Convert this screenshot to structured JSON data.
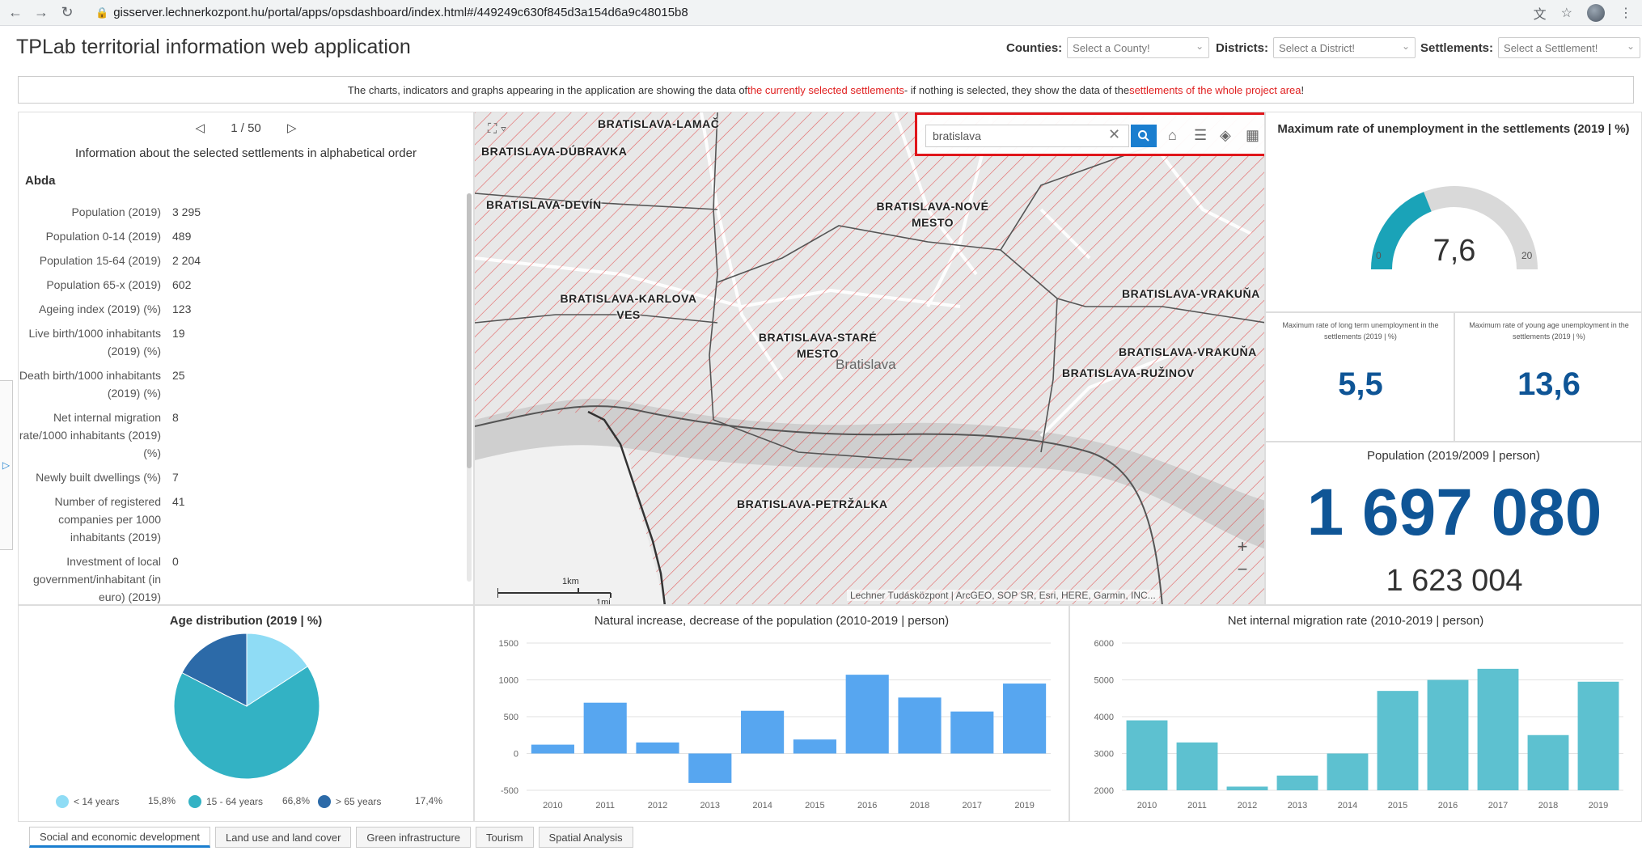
{
  "browser": {
    "url": "gisserver.lechnerkozpont.hu/portal/apps/opsdashboard/index.html#/449249c630f845d3a154d6a9c48015b8"
  },
  "app": {
    "title": "TPLab territorial information web application",
    "filters": [
      {
        "label": "Counties:",
        "placeholder": "Select a County!"
      },
      {
        "label": "Districts:",
        "placeholder": "Select a District!"
      },
      {
        "label": "Settlements:",
        "placeholder": "Select a Settlement!"
      }
    ]
  },
  "notice": {
    "part1": "The charts, indicators and graphs appearing in the application are showing the data of ",
    "part2": "the currently selected settlements",
    "part3": " - if nothing is selected, they show the data of the ",
    "part4": "settlements of the whole project area",
    "part5": "!"
  },
  "list": {
    "pager": "1 / 50",
    "title": "Information about the selected settlements in alphabetical order",
    "name": "Abda",
    "rows": [
      {
        "k": "Population (2019)",
        "v": "3 295"
      },
      {
        "k": "Population 0-14 (2019)",
        "v": "489"
      },
      {
        "k": "Population 15-64 (2019)",
        "v": "2 204"
      },
      {
        "k": "Population 65-x (2019)",
        "v": "602"
      },
      {
        "k": "Ageing index (2019) (%)",
        "v": "123"
      },
      {
        "k": "Live birth/1000 inhabitants (2019) (%)",
        "v": "19"
      },
      {
        "k": "Death birth/1000 inhabitants (2019) (%)",
        "v": "25"
      },
      {
        "k": "Net internal migration rate/1000 inhabitants (2019) (%)",
        "v": "8"
      },
      {
        "k": "Newly built dwellings (%)",
        "v": "7"
      },
      {
        "k": "Number of registered companies per 1000 inhabitants (2019)",
        "v": "41"
      },
      {
        "k": "Investment of local government/inhabitant (in euro) (2019)",
        "v": "0"
      }
    ]
  },
  "map": {
    "search_value": "bratislava",
    "labels": {
      "lamac": "BRATISLAVA-LAMAČ",
      "dubravka": "BRATISLAVA-DÚBRAVKA",
      "devin": "BRATISLAVA-DEVÍN",
      "nove_mesto": "BRATISLAVA-NOVÉ MESTO",
      "karlova_ves": "BRATISLAVA-KARLOVA VES",
      "stare_mesto": "BRATISLAVA-STARÉ MESTO",
      "vrakuna1": "BRATISLAVA-VRAKUŇA",
      "vrakuna2": "BRATISLAVA-VRAKUŇA",
      "ruzinov": "BRATISLAVA-RUŽINOV",
      "petrzalka": "BRATISLAVA-PETRŽALKA"
    },
    "city": "Bratislava",
    "scale_km": "1km",
    "scale_mi": "1mi",
    "attribution": "Lechner Tudásközpont | ArcGEO, SOP SR, Esri, HERE, Garmin, INC..."
  },
  "gauge": {
    "title": "Maximum rate of unemployment in the settlements (2019 | %)",
    "value": "7,6",
    "min": "0",
    "max": "20",
    "value_num": 7.6,
    "max_num": 20,
    "color_fill": "#1aa3b8",
    "color_track": "#d9d9d9"
  },
  "long_term": {
    "title": "Maximum rate of long term unemployment in the settlements (2019 | %)",
    "value": "5,5"
  },
  "young_age": {
    "title": "Maximum rate of young age unemployment in the settlements (2019 | %)",
    "value": "13,6"
  },
  "population": {
    "title": "Population (2019/2009 | person)",
    "value": "1 697 080",
    "reference": "1 623 004"
  },
  "tabs": [
    "Social and economic development",
    "Land use and land cover",
    "Green infrastructure",
    "Tourism",
    "Spatial Analysis"
  ],
  "chart_data": [
    {
      "type": "pie",
      "title": "Age distribution (2019 | %)",
      "slices": [
        {
          "label": "< 14 years",
          "value": 15.8,
          "display": "15,8%",
          "color": "#8fdcf5"
        },
        {
          "label": "15 - 64 years",
          "value": 66.8,
          "display": "66,8%",
          "color": "#33b2c4"
        },
        {
          "label": "> 65 years",
          "value": 17.4,
          "display": "17,4%",
          "color": "#2c6aa8"
        }
      ]
    },
    {
      "type": "bar",
      "title": "Natural increase, decrease of the population (2010-2019 | person)",
      "categories": [
        "2010",
        "2011",
        "2012",
        "2013",
        "2014",
        "2015",
        "2016",
        "2018",
        "2017",
        "2019"
      ],
      "values": [
        120,
        690,
        150,
        -400,
        580,
        190,
        1070,
        760,
        570,
        950
      ],
      "ylim": [
        -500,
        1500
      ],
      "yticks": [
        "-500",
        "0",
        "500",
        "1000",
        "1500"
      ],
      "color": "#57a6f0"
    },
    {
      "type": "bar",
      "title": "Net internal migration rate (2010-2019 | person)",
      "categories": [
        "2010",
        "2011",
        "2012",
        "2013",
        "2014",
        "2015",
        "2016",
        "2017",
        "2018",
        "2019"
      ],
      "values": [
        3900,
        3300,
        2100,
        2400,
        3000,
        4700,
        5000,
        5300,
        3500,
        4950
      ],
      "ylim": [
        2000,
        6000
      ],
      "yticks": [
        "2000",
        "3000",
        "4000",
        "5000",
        "6000"
      ],
      "color": "#5dc1d0"
    }
  ]
}
